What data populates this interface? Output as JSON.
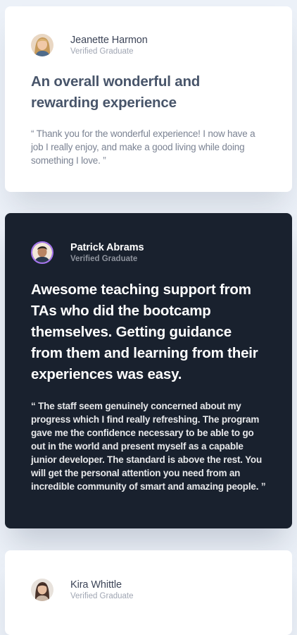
{
  "testimonials": [
    {
      "name": "Jeanette Harmon",
      "role": "Verified Graduate",
      "headline": "An overall wonderful and rewarding experience",
      "quote": "“ Thank you for the wonderful experience! I now have a job I really enjoy, and make a good living while doing something I love. ”"
    },
    {
      "name": "Patrick Abrams",
      "role": "Verified Graduate",
      "headline": "Awesome teaching support from TAs who did the bootcamp themselves. Getting guidance from them and learning from their experiences was easy.",
      "quote": "“ The staff seem genuinely concerned about my progress which I find really refreshing. The program gave me the confidence necessary to be able to go out in the world and present myself as a capable junior developer. The standard is above the rest. You will get the personal attention you need from an incredible community of smart and amazing people. ”"
    },
    {
      "name": "Kira Whittle",
      "role": "Verified Graduate"
    }
  ],
  "colors": {
    "background": "#ECF1F8",
    "light_card": "#FFFFFF",
    "dark_card": "#19212E",
    "avatar_ring": "#A775F1"
  }
}
